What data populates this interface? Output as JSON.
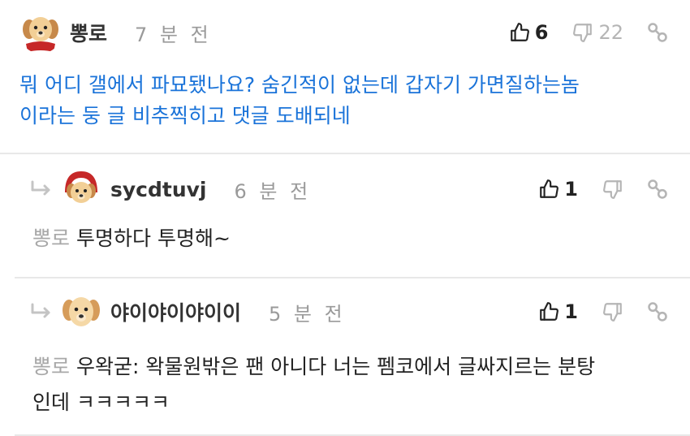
{
  "comments": [
    {
      "nickname": "뽕로",
      "time": "7 분 전",
      "upvotes": "6",
      "downvotes": "22",
      "text_line1": "뭐 어디 갤에서 파묘됐나요? 숨긴적이 없는데 갑자기 가면질하는놈",
      "text_line2": "이라는 둥 글 비추찍히고 댓글 도배되네"
    },
    {
      "nickname": "sycdtuvj",
      "time": "6 분 전",
      "upvotes": "1",
      "mention": "뽕로",
      "text": "투명하다 투명해~"
    },
    {
      "nickname": "야이야이야이이",
      "time": "5 분 전",
      "upvotes": "1",
      "mention": "뽕로",
      "text_line1": "우왁굳: 왁물원밖은 팬 아니다 너는 펨코에서 글싸지르는 분탕",
      "text_line2": "인데 ㅋㅋㅋㅋㅋ"
    }
  ],
  "icons": {
    "thumbs_up": "thumbs-up-icon",
    "thumbs_down": "thumbs-down-icon",
    "link": "link-icon",
    "reply_arrow": "reply-arrow-icon"
  },
  "colors": {
    "op_text": "#1a73d9",
    "muted": "#9a9a9a",
    "divider": "#e8e8e8"
  }
}
